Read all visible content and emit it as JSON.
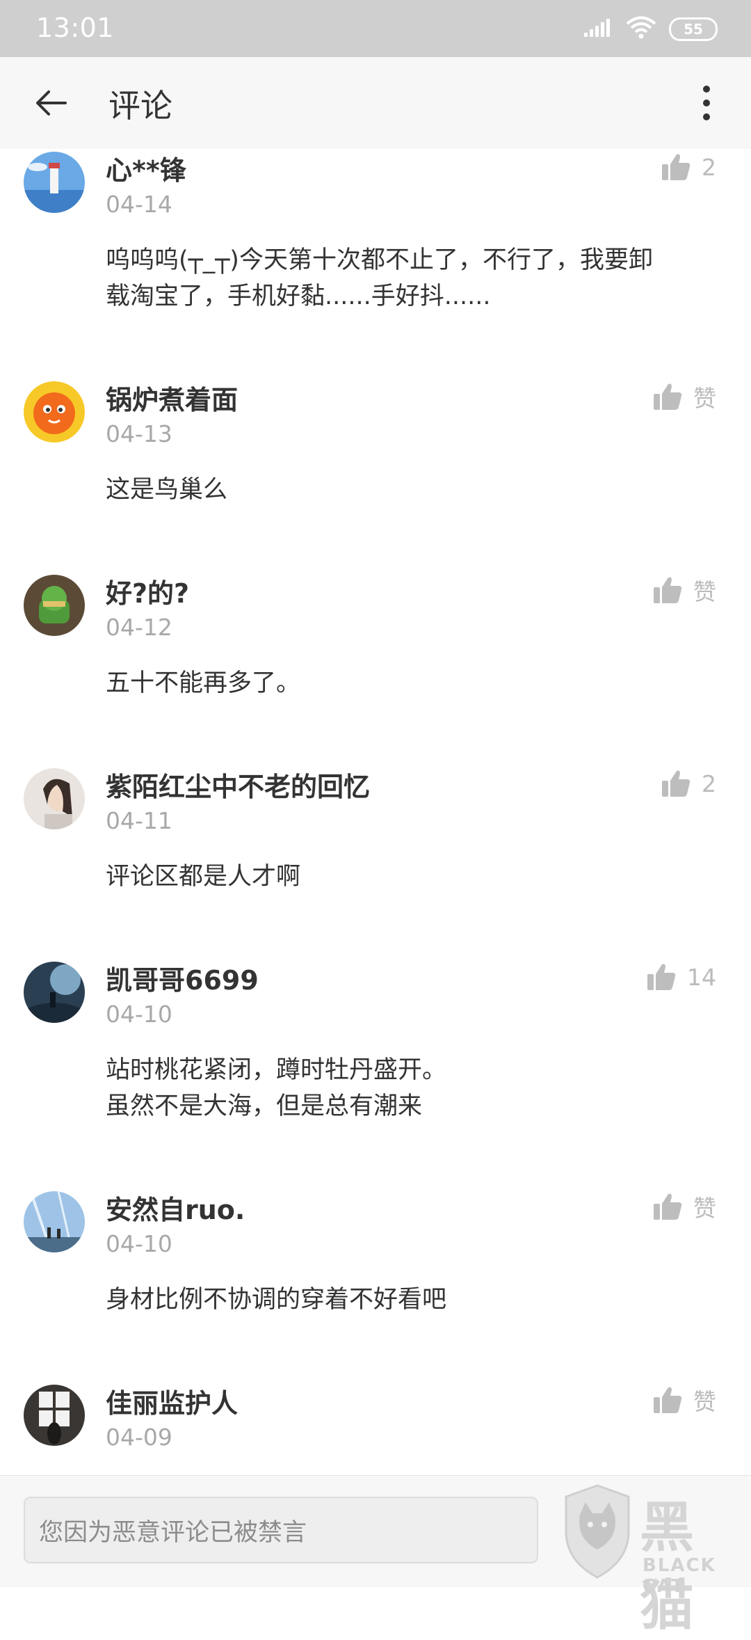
{
  "status_bar": {
    "time": "13:01",
    "battery": "55"
  },
  "header": {
    "title": "评论"
  },
  "comments": [
    {
      "name": "心**锋",
      "date": "04-14",
      "lines": [
        "呜呜呜(┬_┬)今天第十次都不止了，不行了，我要卸",
        "载淘宝了，手机好黏......手好抖......"
      ],
      "likes": "2"
    },
    {
      "name": "锅炉煮着面",
      "date": "04-13",
      "lines": [
        "这是鸟巢么"
      ],
      "likes": "赞"
    },
    {
      "name": "好?的?",
      "date": "04-12",
      "lines": [
        "五十不能再多了。"
      ],
      "likes": "赞"
    },
    {
      "name": "紫陌红尘中不老的回忆",
      "date": "04-11",
      "lines": [
        "评论区都是人才啊"
      ],
      "likes": "2"
    },
    {
      "name": "凯哥哥6699",
      "date": "04-10",
      "lines": [
        "站时桃花紧闭，蹲时牡丹盛开。",
        "虽然不是大海，但是总有潮来"
      ],
      "likes": "14"
    },
    {
      "name": "安然自ruo.",
      "date": "04-10",
      "lines": [
        "身材比例不协调的穿着不好看吧"
      ],
      "likes": "赞"
    },
    {
      "name": "佳丽监护人",
      "date": "04-09",
      "lines": [],
      "likes": "赞"
    }
  ],
  "bottom": {
    "input_placeholder": "您因为恶意评论已被禁言"
  },
  "watermark": {
    "text": "黑猫",
    "sub": "BLACK CAT"
  },
  "icons": {
    "back": "arrow-left-icon",
    "more": "more-vertical-icon",
    "like": "thumbs-up-icon",
    "signal": "signal-icon",
    "wifi": "wifi-icon",
    "battery": "battery-icon"
  }
}
